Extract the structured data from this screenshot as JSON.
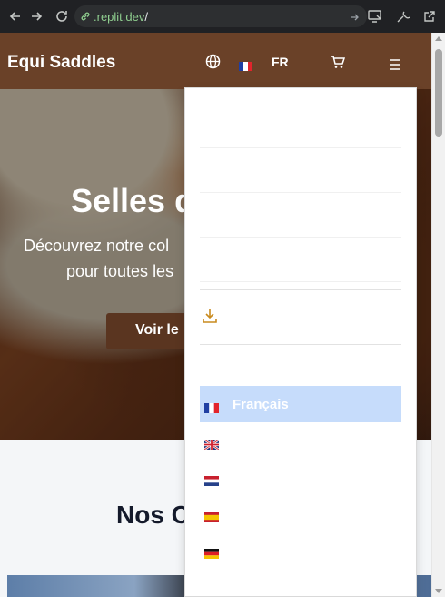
{
  "browser": {
    "url_host": ".replit.dev",
    "url_path": "/",
    "icons": [
      "back-icon",
      "forward-icon",
      "reload-icon",
      "site-info-icon",
      "go-icon",
      "cast-icon",
      "extensions-icon",
      "open-external-icon"
    ]
  },
  "header": {
    "brand": "Equi Saddles",
    "language_code": "FR",
    "icons": [
      "globe-icon",
      "flag-fr-icon",
      "cart-icon",
      "menu-icon"
    ]
  },
  "hero": {
    "title": "Selles d",
    "subtitle_line1": "Découvrez notre col",
    "subtitle_line2": "pour toutes les",
    "button": "Voir le"
  },
  "section": {
    "title": "Nos C"
  },
  "menu": {
    "icons": [
      "download-icon"
    ],
    "languages": [
      {
        "label": "Français",
        "flag": "fr",
        "selected": true
      },
      {
        "label": "",
        "flag": "gb",
        "selected": false
      },
      {
        "label": "",
        "flag": "nl",
        "selected": false
      },
      {
        "label": "",
        "flag": "es",
        "selected": false
      },
      {
        "label": "",
        "flag": "de",
        "selected": false
      }
    ]
  },
  "colors": {
    "header_bg": "#6a4128",
    "button_bg": "#5a3520",
    "selected_bg": "#c6dcfb",
    "download_accent": "#c98b1f"
  }
}
